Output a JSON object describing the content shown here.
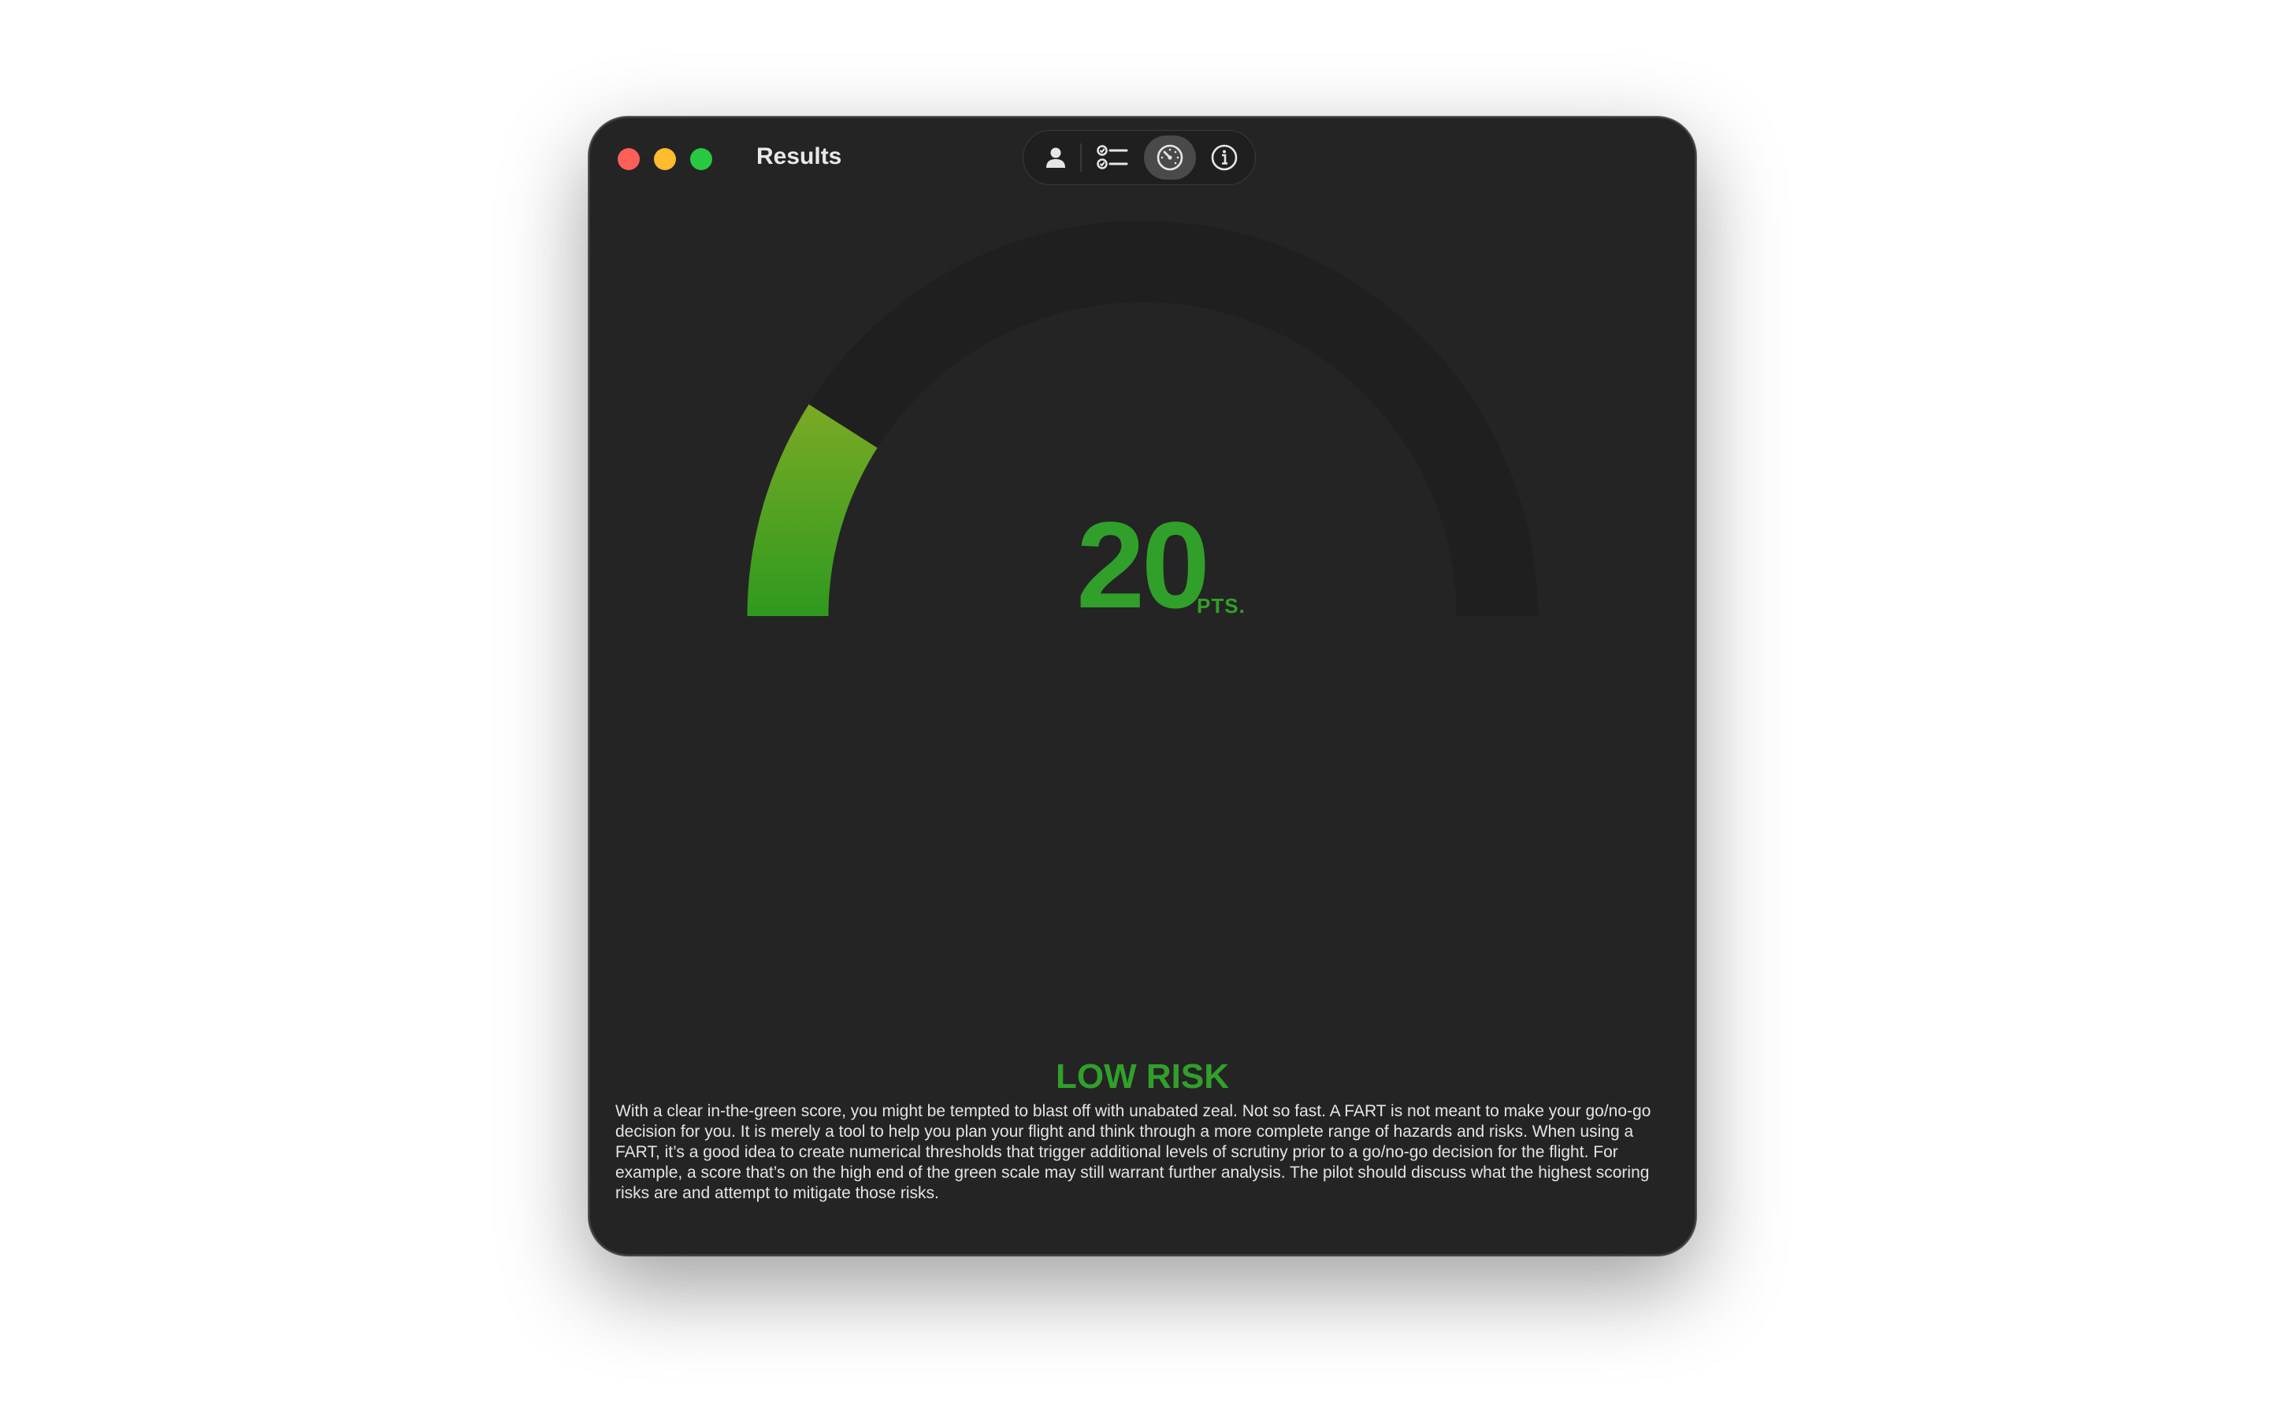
{
  "window": {
    "title": "Results"
  },
  "toolbar": {
    "items": [
      {
        "icon": "person-icon",
        "active": false
      },
      {
        "icon": "checklist-icon",
        "active": false
      },
      {
        "icon": "gauge-icon",
        "active": true
      },
      {
        "icon": "info-icon",
        "active": false
      }
    ]
  },
  "gauge": {
    "score": "20",
    "unit": "PTS.",
    "fill_fraction": 0.18,
    "gradient_start": "#2e9a1e",
    "gradient_end": "#a3b22a",
    "track_color": "#1f1f1f"
  },
  "result": {
    "risk_level": "LOW RISK",
    "risk_color": "#30a02a",
    "description": "With a clear in-the-green score, you might be tempted to blast off with unabated zeal. Not so fast. A FART is not meant to make your go/no-go decision for you. It is merely a tool to help you plan your flight and think through a more complete range of hazards and risks. When using a FART, it’s a good idea to create numerical thresholds that trigger additional levels of scrutiny prior to a go/no-go decision for the flight. For example, a score that’s on the high end of the green scale may still warrant further analysis. The pilot should discuss what the highest scoring risks are and attempt to mitigate those risks."
  }
}
